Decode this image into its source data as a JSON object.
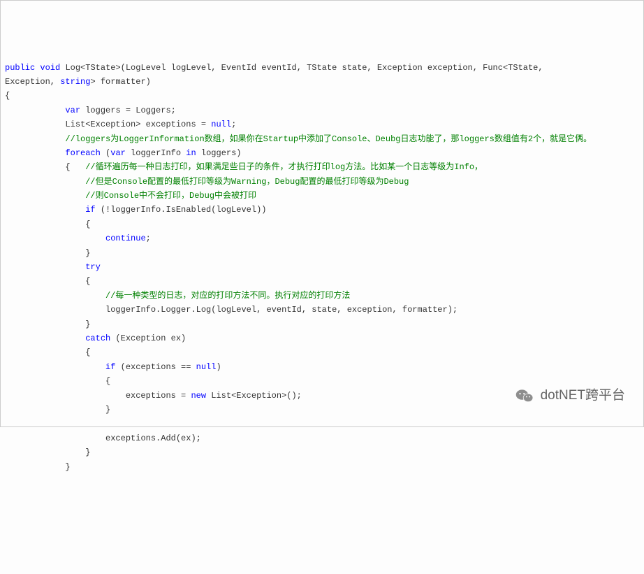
{
  "code": {
    "sig1a": "public",
    "sig1b": "void",
    "sig1c": "Log<TState>(LogLevel logLevel, EventId eventId, TState state, Exception exception, Func<TState,",
    "sig2": "Exception,",
    "sig2b": "string",
    "sig2c": "> formatter)",
    "open": "{",
    "l1a": "var",
    "l1b": " loggers = Loggers;",
    "l2a": "List<Exception> exceptions = ",
    "l2b": "null",
    "l2c": ";",
    "c1": "//loggers为LoggerInformation数组，如果你在Startup中添加了Console、Deubg日志功能了，那loggers数组值有2个，就是它俩。",
    "l3a": "foreach",
    "l3b": " (",
    "l3c": "var",
    "l3d": " loggerInfo ",
    "l3e": "in",
    "l3f": " loggers)",
    "br1": "{   ",
    "c2": "//循环遍历每一种日志打印，如果满足些日子的条件，才执行打印log方法。比如某一个日志等级为Info，",
    "c3": "//但是Console配置的最低打印等级为Warning，Debug配置的最低打印等级为Debug",
    "c4": "//则Console中不会打印，Debug中会被打印",
    "l4a": "if",
    "l4b": " (!loggerInfo.IsEnabled(logLevel))",
    "br2": "{",
    "l5a": "continue",
    "l5b": ";",
    "br3": "}",
    "l6": "try",
    "br4": "{",
    "c5": "//每一种类型的日志，对应的打印方法不同。执行对应的打印方法",
    "l7": "loggerInfo.Logger.Log(logLevel, eventId, state, exception, formatter);",
    "br5": "}",
    "l8a": "catch",
    "l8b": " (Exception ex)",
    "br6": "{",
    "l9a": "if",
    "l9b": " (exceptions == ",
    "l9c": "null",
    "l9d": ")",
    "br7": "{",
    "l10a": "exceptions = ",
    "l10b": "new",
    "l10c": " List<Exception>();",
    "br8": "}",
    "blank": "",
    "l11": "exceptions.Add(ex);",
    "br9": "}",
    "br10": "}"
  },
  "watermark": "dotNET跨平台"
}
